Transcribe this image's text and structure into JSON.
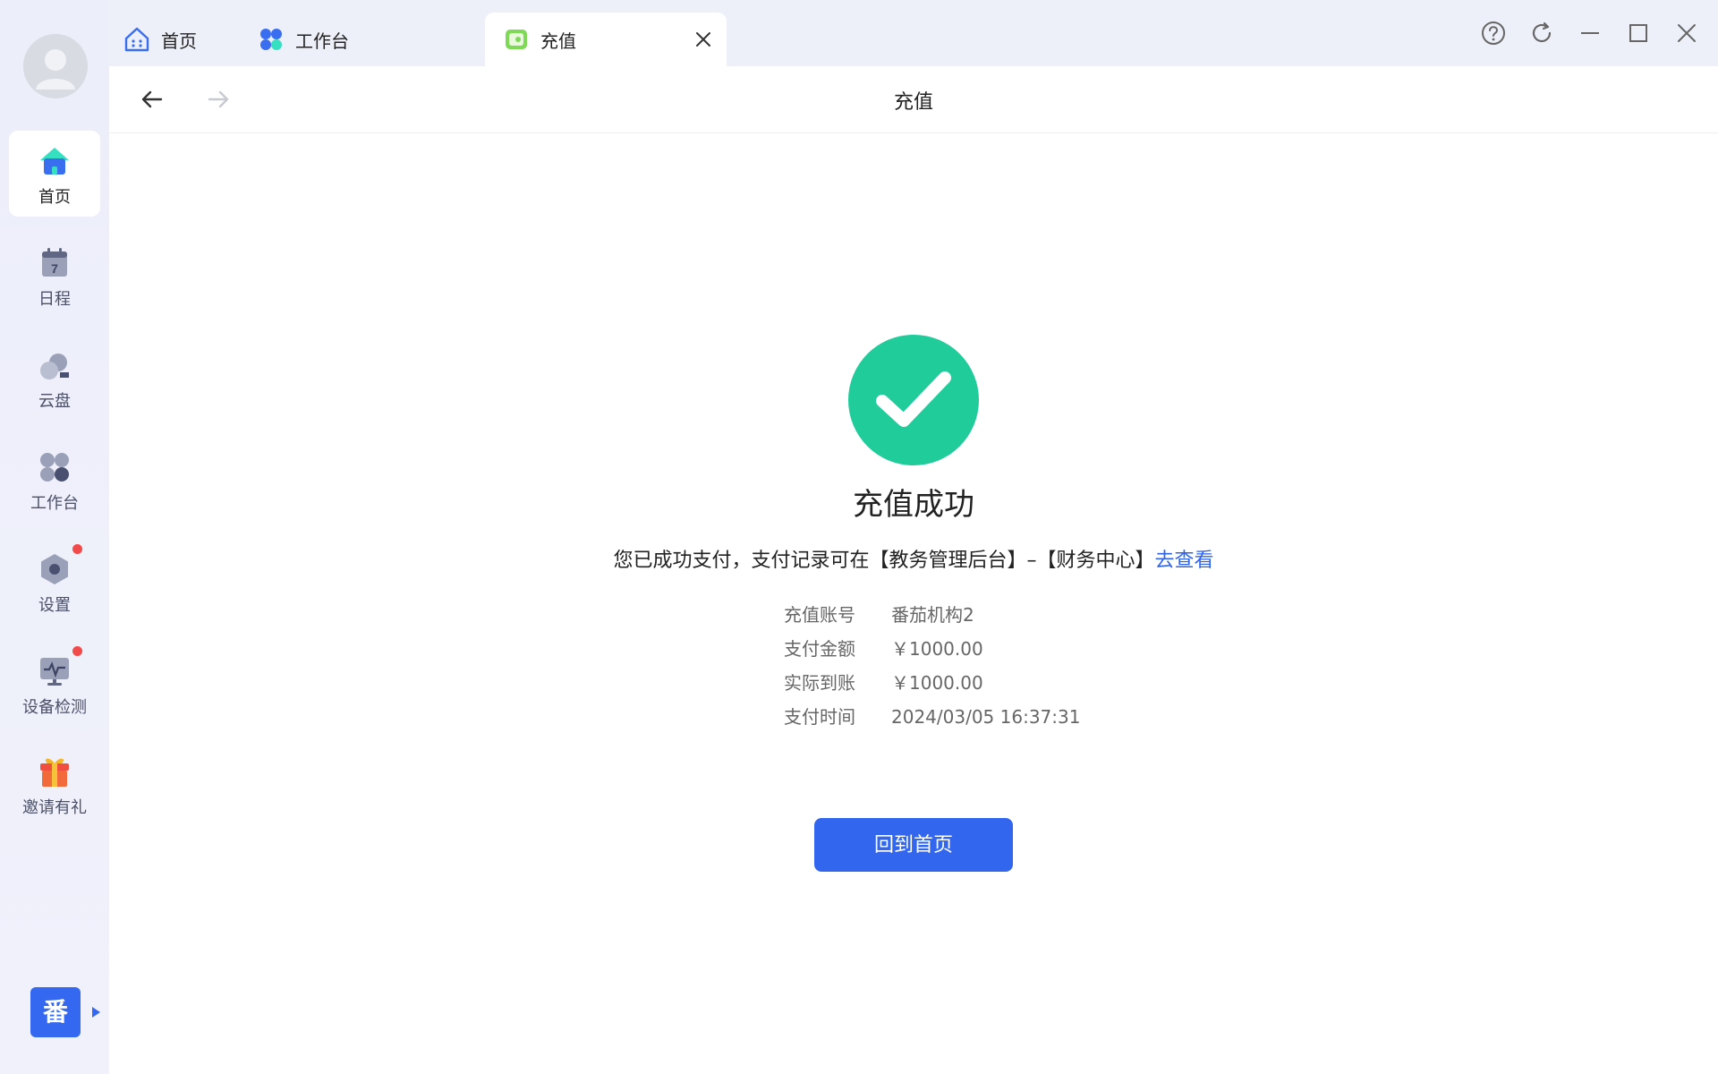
{
  "sidebar": {
    "items": [
      {
        "label": "首页",
        "icon": "home-icon"
      },
      {
        "label": "日程",
        "icon": "calendar-icon",
        "calendar_day": "7"
      },
      {
        "label": "云盘",
        "icon": "cloud-icon"
      },
      {
        "label": "工作台",
        "icon": "workbench-icon"
      },
      {
        "label": "设置",
        "icon": "settings-icon"
      },
      {
        "label": "设备检测",
        "icon": "monitor-icon"
      },
      {
        "label": "邀请有礼",
        "icon": "gift-icon"
      }
    ],
    "brand_glyph": "番"
  },
  "tabs": [
    {
      "label": "首页"
    },
    {
      "label": "工作台"
    },
    {
      "label": "充值"
    }
  ],
  "page": {
    "title": "充值"
  },
  "result": {
    "title": "充值成功",
    "description": "您已成功支付，支付记录可在【教务管理后台】–【财务中心】",
    "link": "去查看",
    "details": [
      {
        "label": "充值账号",
        "value": "番茄机构2"
      },
      {
        "label": "支付金额",
        "value": "￥1000.00"
      },
      {
        "label": "实际到账",
        "value": "￥1000.00"
      },
      {
        "label": "支付时间",
        "value": "2024/03/05 16:37:31"
      }
    ],
    "button": "回到首页"
  },
  "colors": {
    "accent": "#3366ee",
    "success": "#1fcc9a",
    "link": "#2f63ef",
    "badge": "#f04a4a"
  }
}
